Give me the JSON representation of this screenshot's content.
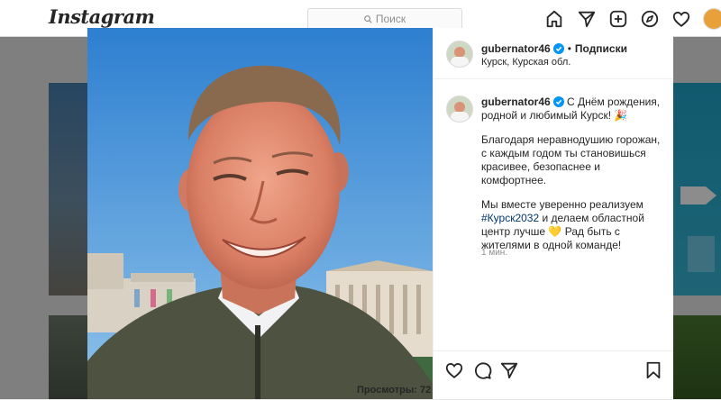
{
  "header": {
    "logo": "Instagram",
    "search_placeholder": "Поиск"
  },
  "post": {
    "username": "gubernator46",
    "follow_label": "Подписки",
    "dot": "•",
    "location": "Курск, Курская обл.",
    "caption": {
      "username": "gubernator46",
      "p1": "С Днём рождения, родной и любимый Курск! 🎉",
      "p2": "Благодаря неравнодушию горожан, с каждым годом ты становишься красивее, безопаснее и комфортнее.",
      "p3_before": "Мы вместе уверенно реализуем ",
      "p3_hashtag": "#Курск2032",
      "p3_after": " и делаем областной центр лучше 💛 Рад быть с жителями в одной команде!"
    },
    "time": "1 мин.",
    "views": "Просмотры: 72"
  },
  "colors": {
    "accent": "#0095f6",
    "hashtag": "#00376b",
    "sky": "#3a8fd5"
  },
  "icons": [
    "search-icon",
    "home-icon",
    "direct-icon",
    "new-post-icon",
    "explore-icon",
    "heart-icon",
    "comment-icon",
    "share-icon",
    "bookmark-icon",
    "verified-icon"
  ]
}
